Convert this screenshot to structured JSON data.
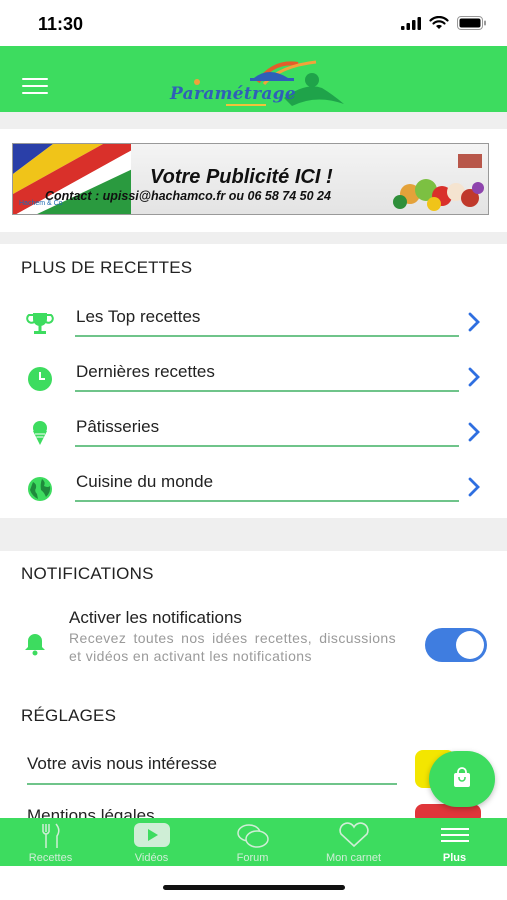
{
  "status_bar": {
    "time": "11:30"
  },
  "header": {
    "logo_text": "Paramétrage"
  },
  "ad": {
    "title": "Votre Publicité ICI !",
    "contact": "Contact : upissi@hachamco.fr  ou  06 58 74 50 24",
    "small_brand": "Hachem & Co"
  },
  "recipes_section": {
    "title": "PLUS DE RECETTES",
    "items": [
      {
        "label": "Les Top recettes",
        "icon": "trophy-icon"
      },
      {
        "label": "Dernières recettes",
        "icon": "clock-icon"
      },
      {
        "label": "Pâtisseries",
        "icon": "ice-cream-icon"
      },
      {
        "label": "Cuisine du monde",
        "icon": "globe-icon"
      }
    ]
  },
  "notifications": {
    "title": "NOTIFICATIONS",
    "toggle_label": "Activer les notifications",
    "toggle_description": "Recevez toutes nos idées recettes, discussions et vidéos en activant les notifications",
    "enabled": true
  },
  "settings": {
    "title": "RÉGLAGES",
    "items": [
      {
        "label": "Votre avis nous intéresse"
      },
      {
        "label": "Mentions légales"
      }
    ]
  },
  "tab_bar": {
    "tabs": [
      {
        "label": "Recettes",
        "icon": "utensils-icon",
        "active": false
      },
      {
        "label": "Vidéos",
        "icon": "play-icon",
        "active": false
      },
      {
        "label": "Forum",
        "icon": "chat-bubbles-icon",
        "active": false
      },
      {
        "label": "Mon carnet",
        "icon": "heart-icon",
        "active": false
      },
      {
        "label": "Plus",
        "icon": "menu-icon",
        "active": true
      }
    ]
  },
  "colors": {
    "primary_green": "#3ddc5f",
    "toggle_blue": "#3f7de0",
    "chevron_blue": "#2f6fe0"
  }
}
